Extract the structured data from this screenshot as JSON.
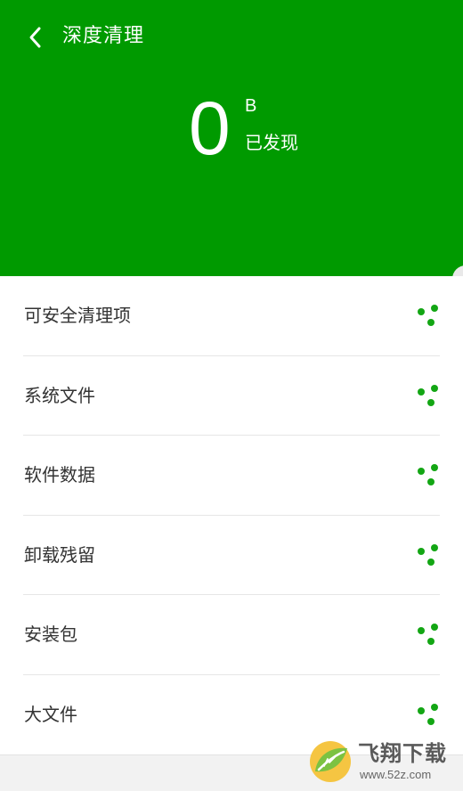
{
  "header": {
    "title": "深度清理",
    "size_value": "0",
    "size_unit": "B",
    "found_label": "已发现",
    "background_color": "#009a00"
  },
  "list": {
    "items": [
      {
        "label": "可安全清理项",
        "status_icon": "loading-dots-icon"
      },
      {
        "label": "系统文件",
        "status_icon": "loading-dots-icon"
      },
      {
        "label": "软件数据",
        "status_icon": "loading-dots-icon"
      },
      {
        "label": "卸载残留",
        "status_icon": "loading-dots-icon"
      },
      {
        "label": "安装包",
        "status_icon": "loading-dots-icon"
      },
      {
        "label": "大文件",
        "status_icon": "loading-dots-icon"
      }
    ],
    "accent_color": "#13a614"
  },
  "watermark": {
    "text": "飞翔下载",
    "url": "www.52z.com"
  }
}
